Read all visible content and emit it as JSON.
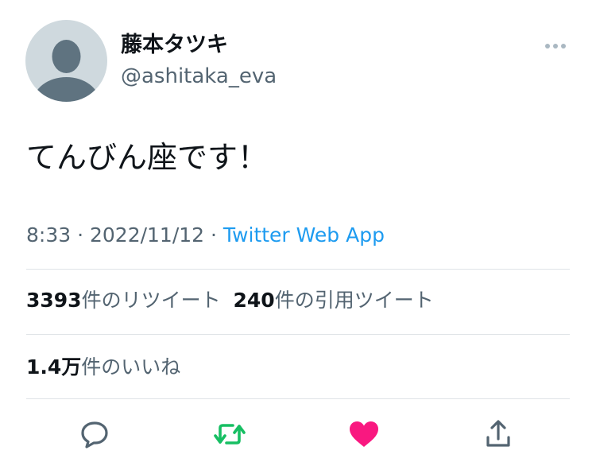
{
  "user": {
    "display_name": "藤本タツキ",
    "handle": "@ashitaka_eva",
    "avatar_icon": "default-avatar-icon"
  },
  "menu_icon": "more-dots-icon",
  "tweet": {
    "text": "てんびん座です！",
    "time": "8:33",
    "separator1": " · ",
    "date": "2022/11/12",
    "separator2": " · ",
    "source": "Twitter Web App"
  },
  "stats": {
    "retweets_count": "3393",
    "retweets_label": "件のリツイート",
    "quotes_count": "240",
    "quotes_label": "件の引用ツイート",
    "likes_count": "1.4万",
    "likes_label": "件のいいね"
  },
  "actions": {
    "reply_icon": "reply-icon",
    "retweet_icon": "retweet-icon",
    "like_icon": "heart-icon",
    "share_icon": "share-icon"
  },
  "colors": {
    "retweet_active": "#17bf63",
    "like_active": "#f91880",
    "link": "#1d9bf0",
    "secondary_text": "#536471"
  }
}
